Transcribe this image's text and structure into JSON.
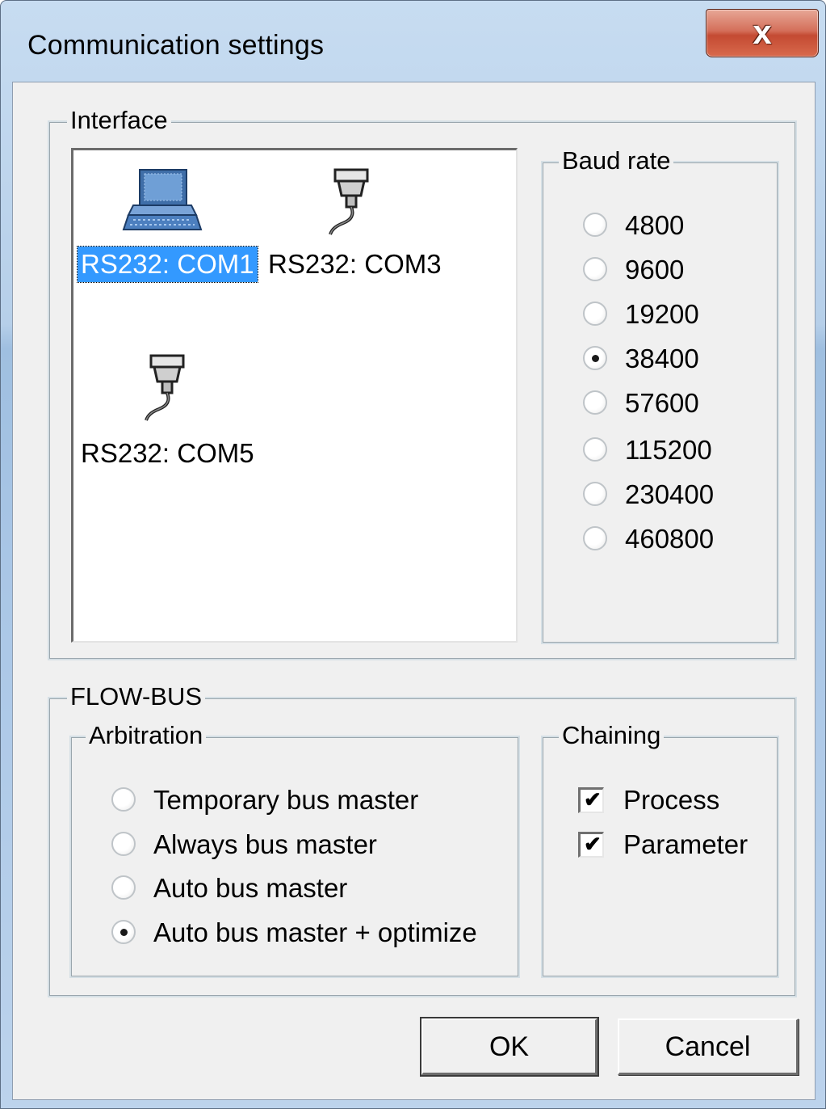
{
  "window": {
    "title": "Communication settings",
    "close_glyph": "x"
  },
  "interface": {
    "label": "Interface",
    "items": [
      {
        "label": "RS232: COM1",
        "icon": "computer-icon",
        "selected": true
      },
      {
        "label": "RS232: COM3",
        "icon": "serial-cable-icon",
        "selected": false
      },
      {
        "label": "RS232: COM5",
        "icon": "serial-cable-icon",
        "selected": false
      }
    ]
  },
  "baud_rate": {
    "label": "Baud rate",
    "options": [
      "4800",
      "9600",
      "19200",
      "38400",
      "57600",
      "115200",
      "230400",
      "460800"
    ],
    "selected": "38400"
  },
  "flowbus": {
    "label": "FLOW-BUS",
    "arbitration": {
      "label": "Arbitration",
      "options": [
        "Temporary bus master",
        "Always bus master",
        "Auto bus master",
        "Auto bus master + optimize"
      ],
      "selected": "Auto bus master + optimize"
    },
    "chaining": {
      "label": "Chaining",
      "options": [
        {
          "label": "Process",
          "checked": true
        },
        {
          "label": "Parameter",
          "checked": true
        }
      ]
    }
  },
  "buttons": {
    "ok": "OK",
    "cancel": "Cancel"
  },
  "colors": {
    "selection": "#3399ff",
    "dialog_bg": "#f0f0f0",
    "close_button": "#c8462e"
  }
}
